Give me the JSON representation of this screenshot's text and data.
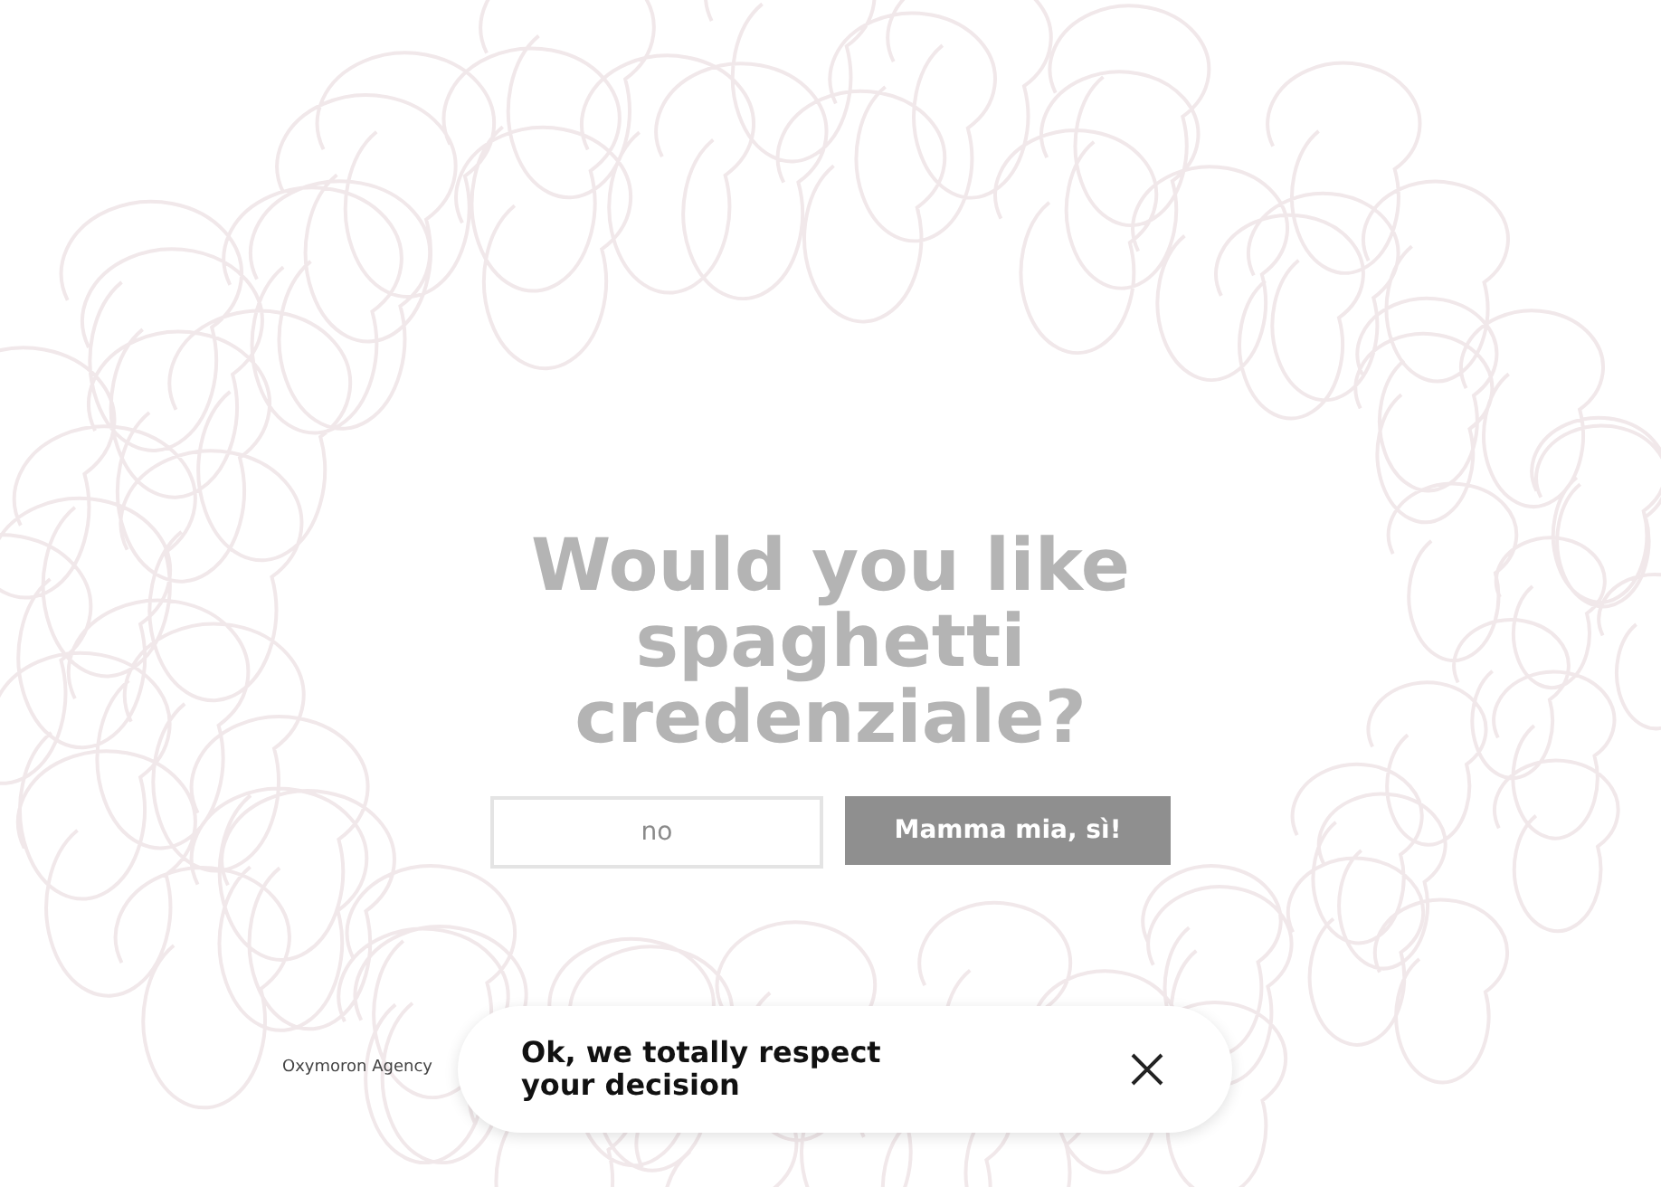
{
  "heading": "Would you like spaghetti credenziale?",
  "buttons": [
    {
      "label": "no",
      "kind": "outline"
    },
    {
      "label": "Mamma mia, sì!",
      "kind": "filled"
    }
  ],
  "agency": "Oxymoron Agency",
  "toast": {
    "message": "Ok, we totally respect your decision"
  }
}
